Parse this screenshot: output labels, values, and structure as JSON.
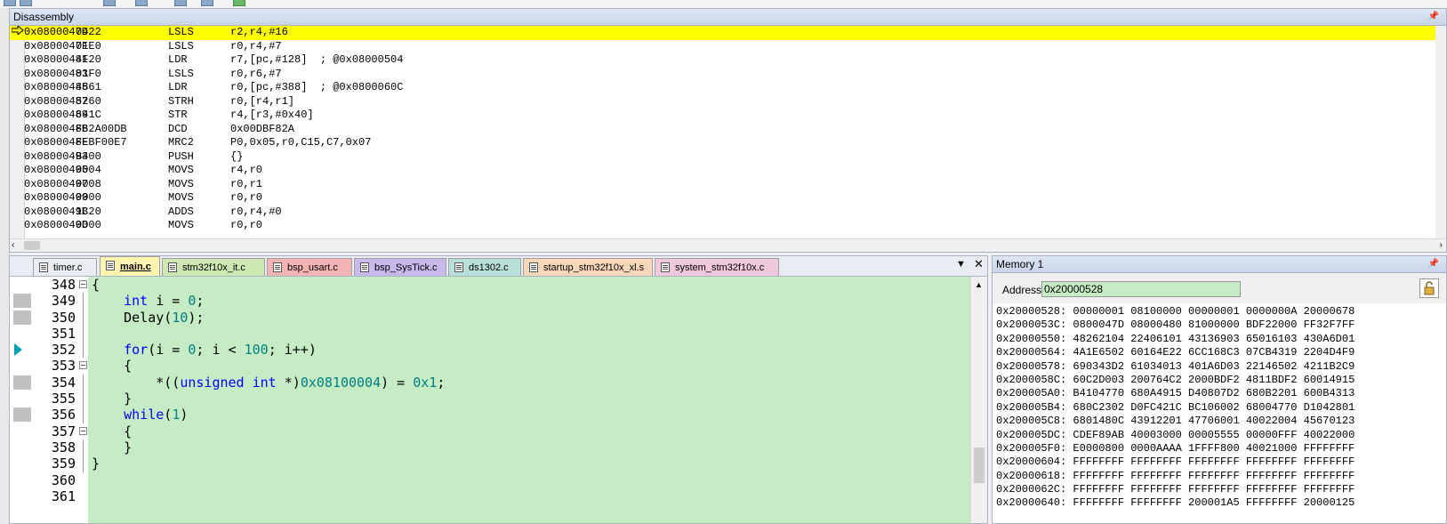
{
  "disassembly": {
    "title": "Disassembly",
    "rows": [
      {
        "addr": "0x0800047D",
        "hex": "0422",
        "mnemonic": "LSLS",
        "operands": "r2,r4,#16"
      },
      {
        "addr": "0x0800047F",
        "hex": "01E0",
        "mnemonic": "LSLS",
        "operands": "r0,r4,#7"
      },
      {
        "addr": "0x08000481",
        "hex": "4F20",
        "mnemonic": "LDR",
        "operands": "r7,[pc,#128]  ; @0x08000504"
      },
      {
        "addr": "0x08000483",
        "hex": "01F0",
        "mnemonic": "LSLS",
        "operands": "r0,r6,#7"
      },
      {
        "addr": "0x08000485",
        "hex": "4861",
        "mnemonic": "LDR",
        "operands": "r0,[pc,#388]  ; @0x0800060C"
      },
      {
        "addr": "0x08000487",
        "hex": "5260",
        "mnemonic": "STRH",
        "operands": "r0,[r4,r1]"
      },
      {
        "addr": "0x08000489",
        "hex": "641C",
        "mnemonic": "STR",
        "operands": "r4,[r3,#0x40]"
      },
      {
        "addr": "0x0800048B",
        "hex": "F82A00DB",
        "mnemonic": "DCD",
        "operands": "0x00DBF82A"
      },
      {
        "addr": "0x0800048F",
        "hex": "FEBF00E7",
        "mnemonic": "MRC2",
        "operands": "P0,0x05,r0,C15,C7,0x07"
      },
      {
        "addr": "0x08000493",
        "hex": "B400",
        "mnemonic": "PUSH",
        "operands": "{}"
      },
      {
        "addr": "0x08000495",
        "hex": "0004",
        "mnemonic": "MOVS",
        "operands": "r4,r0"
      },
      {
        "addr": "0x08000497",
        "hex": "0008",
        "mnemonic": "MOVS",
        "operands": "r0,r1"
      },
      {
        "addr": "0x08000499",
        "hex": "0000",
        "mnemonic": "MOVS",
        "operands": "r0,r0"
      },
      {
        "addr": "0x0800049B",
        "hex": "1C20",
        "mnemonic": "ADDS",
        "operands": "r0,r4,#0"
      },
      {
        "addr": "0x0800049D",
        "hex": "0000",
        "mnemonic": "MOVS",
        "operands": "r0,r0"
      }
    ]
  },
  "editor": {
    "tabs": [
      {
        "label": "timer.c",
        "color": "#e9edf3"
      },
      {
        "label": "main.c",
        "color": "#fff4b0"
      },
      {
        "label": "stm32f10x_it.c",
        "color": "#cde8b0"
      },
      {
        "label": "bsp_usart.c",
        "color": "#f4b4b4"
      },
      {
        "label": "bsp_SysTick.c",
        "color": "#c8b8ec"
      },
      {
        "label": "ds1302.c",
        "color": "#b8e0d8"
      },
      {
        "label": "startup_stm32f10x_xl.s",
        "color": "#f8d8b8"
      },
      {
        "label": "system_stm32f10x.c",
        "color": "#f0c8dc"
      }
    ],
    "lines": [
      {
        "n": "348",
        "text": "{"
      },
      {
        "n": "349",
        "text": "    int i = 0;"
      },
      {
        "n": "350",
        "text": "    Delay(10);"
      },
      {
        "n": "351",
        "text": ""
      },
      {
        "n": "352",
        "text": "    for(i = 0; i < 100; i++)"
      },
      {
        "n": "353",
        "text": "    {"
      },
      {
        "n": "354",
        "text": "        *((unsigned int *)0x08100004) = 0x1;"
      },
      {
        "n": "355",
        "text": "    }"
      },
      {
        "n": "356",
        "text": "    while(1)"
      },
      {
        "n": "357",
        "text": "    {"
      },
      {
        "n": "358",
        "text": "    }"
      },
      {
        "n": "359",
        "text": "}"
      },
      {
        "n": "360",
        "text": ""
      },
      {
        "n": "361",
        "text": ""
      }
    ]
  },
  "memory": {
    "title": "Memory 1",
    "address_label": "Address:",
    "address_value": "0x20000528",
    "rows": [
      "0x20000528: 00000001 08100000 00000001 0000000A 20000678",
      "0x2000053C: 0800047D 08000480 81000000 BDF22000 FF32F7FF",
      "0x20000550: 48262104 22406101 43136903 65016103 430A6D01",
      "0x20000564: 4A1E6502 60164E22 6CC168C3 07CB4319 2204D4F9",
      "0x20000578: 690343D2 61034013 401A6D03 22146502 4211B2C9",
      "0x2000058C: 60C2D003 200764C2 2000BDF2 4811BDF2 60014915",
      "0x200005A0: B4104770 680A4915 D40807D2 680B2201 600B4313",
      "0x200005B4: 680C2302 D0FC421C BC106002 68004770 D1042801",
      "0x200005C8: 6801480C 43912201 47706001 40022004 45670123",
      "0x200005DC: CDEF89AB 40003000 00005555 00000FFF 40022000",
      "0x200005F0: E0000800 0000AAAA 1FFFF800 40021000 FFFFFFFF",
      "0x20000604: FFFFFFFF FFFFFFFF FFFFFFFF FFFFFFFF FFFFFFFF",
      "0x20000618: FFFFFFFF FFFFFFFF FFFFFFFF FFFFFFFF FFFFFFFF",
      "0x2000062C: FFFFFFFF FFFFFFFF FFFFFFFF FFFFFFFF FFFFFFFF",
      "0x20000640: FFFFFFFF FFFFFFFF 200001A5 FFFFFFFF 20000125"
    ]
  }
}
